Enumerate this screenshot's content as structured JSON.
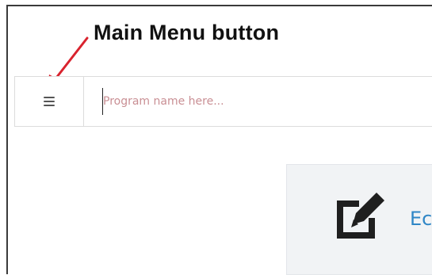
{
  "annotation": {
    "text": "Main Menu button",
    "arrow_color": "#d9232e"
  },
  "toolbar": {
    "menu_button_icon": "hamburger-menu-icon",
    "program_input": {
      "value": "",
      "placeholder": "Program name here..."
    }
  },
  "card": {
    "icon": "edit-icon",
    "label": "Ec"
  }
}
